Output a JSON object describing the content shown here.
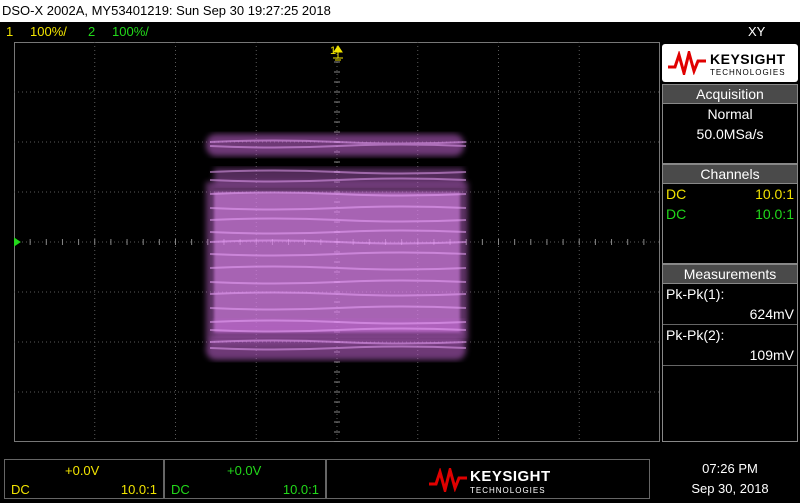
{
  "title": "DSO-X 2002A, MY53401219: Sun Sep 30 19:27:25 2018",
  "channels_bar": {
    "ch1_num": "1",
    "ch1_scale": "100%/",
    "ch2_num": "2",
    "ch2_scale": "100%/",
    "mode": "XY"
  },
  "markers": {
    "ch1": "1",
    "ch2": "2"
  },
  "logo": {
    "brand": "KEYSIGHT",
    "sub": "TECHNOLOGIES"
  },
  "acquisition": {
    "header": "Acquisition",
    "mode": "Normal",
    "rate": "50.0MSa/s"
  },
  "channels_panel": {
    "header": "Channels",
    "ch1": {
      "coupling": "DC",
      "ratio": "10.0:1"
    },
    "ch2": {
      "coupling": "DC",
      "ratio": "10.0:1"
    }
  },
  "measurements": {
    "header": "Measurements",
    "m1_label": "Pk-Pk(1):",
    "m1_value": "624mV",
    "m2_label": "Pk-Pk(2):",
    "m2_value": "109mV"
  },
  "bottom": {
    "ch1": {
      "offset": "+0.0V",
      "coupling": "DC",
      "ratio": "10.0:1"
    },
    "ch2": {
      "offset": "+0.0V",
      "coupling": "DC",
      "ratio": "10.0:1"
    },
    "logo_brand": "KEYSIGHT",
    "logo_sub": "TECHNOLOGIES",
    "time": "07:26 PM",
    "date": "Sep 30, 2018"
  },
  "colors": {
    "ch1": "#f2e400",
    "ch2": "#22d81a",
    "trace": "#e080f0"
  }
}
